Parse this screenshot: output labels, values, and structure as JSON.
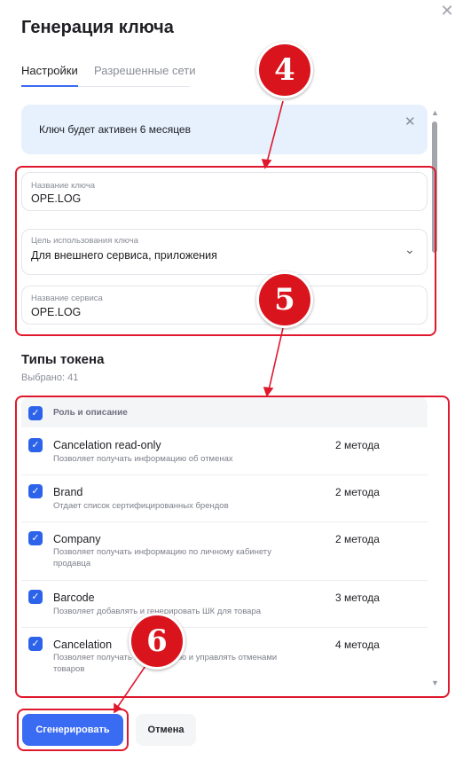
{
  "dialog": {
    "title": "Генерация ключа",
    "close_icon": "close-icon",
    "tabs": [
      {
        "label": "Настройки",
        "active": true
      },
      {
        "label": "Разрешенные сети",
        "active": false
      }
    ]
  },
  "banner": {
    "text": "Ключ будет активен 6 месяцев",
    "background": "#e6f1fd"
  },
  "fields": {
    "key_name": {
      "label": "Название ключа",
      "value": "OPE.LOG"
    },
    "purpose": {
      "label": "Цель использования ключа",
      "value": "Для внешнего сервиса, приложения"
    },
    "service_name": {
      "label": "Название сервиса",
      "value": "OPE.LOG"
    }
  },
  "token_types": {
    "title": "Типы токена",
    "selected": "Выбрано: 41",
    "header": "Роль и описание",
    "rows": [
      {
        "name": "Cancelation read-only",
        "desc": "Позволяет получать информацию об отменах",
        "methods": "2 метода"
      },
      {
        "name": "Brand",
        "desc": "Отдает список сертифицированных брендов",
        "methods": "2 метода"
      },
      {
        "name": "Company",
        "desc": "Позволяет получать информацию по личному кабинету продавца",
        "methods": "2 метода"
      },
      {
        "name": "Barcode",
        "desc": "Позволяет добавлять и генерировать ШК для товара",
        "methods": "3 метода"
      },
      {
        "name": "Cancelation",
        "desc": "Позволяет получать информацию и управлять отменами товаров",
        "methods": "4 метода"
      }
    ]
  },
  "buttons": {
    "generate": "Сгенерировать",
    "cancel": "Отмена"
  },
  "annotations": {
    "step4": "4",
    "step5": "5",
    "step6": "6",
    "color": "#e0182d"
  },
  "accent_color": "#3a6bf3"
}
